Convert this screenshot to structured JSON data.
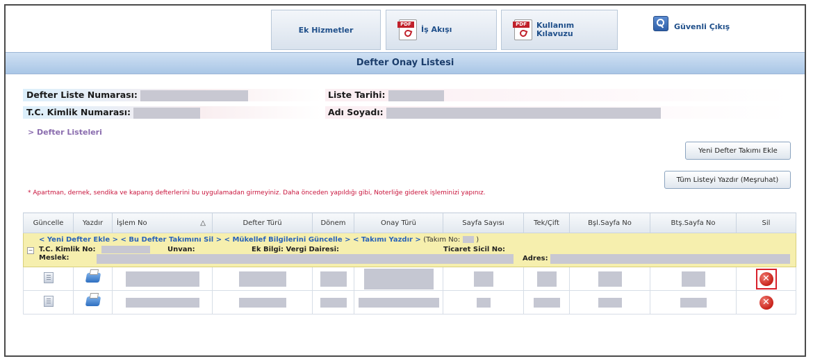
{
  "nav": {
    "ek_hizmetler": "Ek Hizmetler",
    "is_akisi": "İş Akışı",
    "kullanim_line1": "Kullanım",
    "kullanim_line2": "Kılavuzu",
    "logout": "Güvenli Çıkış"
  },
  "page": {
    "title": "Defter Onay Listesi"
  },
  "info": {
    "defter_liste_no_label": "Defter Liste Numarası:",
    "liste_tarihi_label": "Liste Tarihi:",
    "tc_kimlik_label": "T.C. Kimlik Numarası:",
    "adi_soyadi_label": "Adı Soyadı:"
  },
  "links": {
    "defter_listeleri": "> Defter Listeleri"
  },
  "buttons": {
    "yeni_defter_takimi": "Yeni Defter Takımı Ekle",
    "tum_listeyi_yazdir": "Tüm Listeyi Yazdır (Meşruhat)"
  },
  "warning": "* Apartman, dernek, sendika ve kapanış defterlerini bu uygulamadan girmeyiniz. Daha önceden yapıldığı gibi, Noterliğe giderek işleminizi yapınız.",
  "table": {
    "columns": [
      "Güncelle",
      "Yazdır",
      "İşlem No",
      "Defter Türü",
      "Dönem",
      "Onay Türü",
      "Sayfa Sayısı",
      "Tek/Çift",
      "Bşl.Sayfa No",
      "Btş.Sayfa No",
      "Sil"
    ],
    "sort_indicator": "△",
    "group": {
      "link_yeni_defter": "< Yeni Defter Ekle >",
      "link_takim_sil": "< Bu Defter Takımını Sil >",
      "link_mukellef": "< Mükellef Bilgilerini Güncelle >",
      "link_takim_yazdir": "< Takımı Yazdır >",
      "takim_no_label": "(Takım No:",
      "takim_no_close": ")",
      "collapse_symbol": "−",
      "tc_kimlik_label": "T.C. Kimlik No:",
      "unvan_label": "Unvan:",
      "ek_bilgi_label": "Ek Bilgi: Vergi Dairesi:",
      "ticaret_sicil_label": "Ticaret Sicil No:",
      "meslek_label": "Meslek:",
      "adres_label": "Adres:"
    },
    "row_count": 2
  },
  "icons": {
    "pdf": "pdf-icon",
    "key": "key-icon",
    "edit": "edit-icon",
    "print": "printer-icon",
    "delete": "delete-icon"
  },
  "colors": {
    "title_bar": "#a9c6e6",
    "group_row": "#f6efae",
    "warning": "#c8123a",
    "link": "#2a63b8",
    "delete": "#c8221a"
  }
}
